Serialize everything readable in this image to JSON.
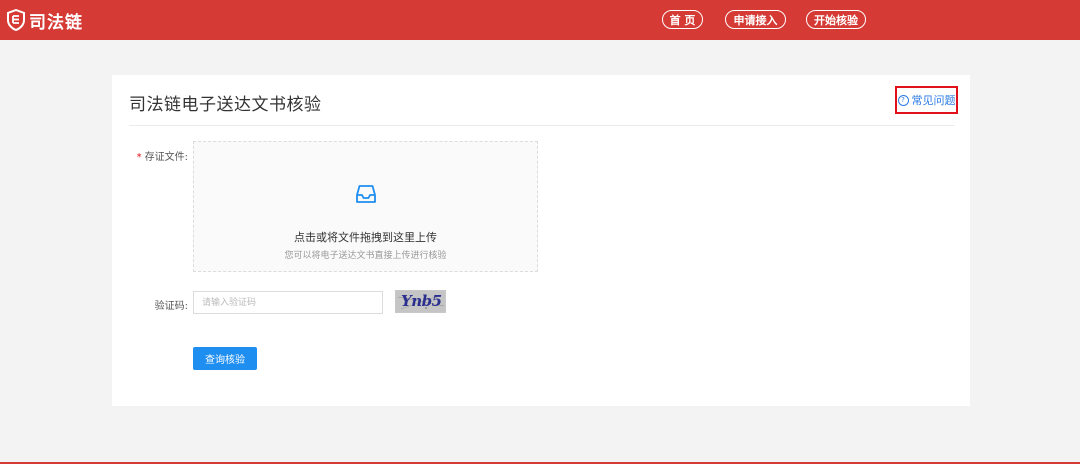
{
  "header": {
    "logo_text": "司法链",
    "logo_icon": "shield-icon",
    "nav": [
      {
        "label": "首 页"
      },
      {
        "label": "申请接入"
      },
      {
        "label": "开始核验"
      }
    ],
    "brand_color": "#d53a35"
  },
  "main": {
    "title": "司法链电子送达文书核验",
    "faq_label": "常见问题",
    "faq_icon": "question-circle-icon",
    "file_field": {
      "required_mark": "*",
      "label": "存证文件:",
      "upload_icon": "inbox-icon",
      "upload_main": "点击或将文件拖拽到这里上传",
      "upload_sub": "您可以将电子送达文书直接上传进行核验"
    },
    "captcha_field": {
      "label": "验证码:",
      "placeholder": "请输入验证码",
      "value": "",
      "captcha_text": "Ynb5"
    },
    "submit_label": "查询核验",
    "accent_color": "#1e8ef0"
  }
}
